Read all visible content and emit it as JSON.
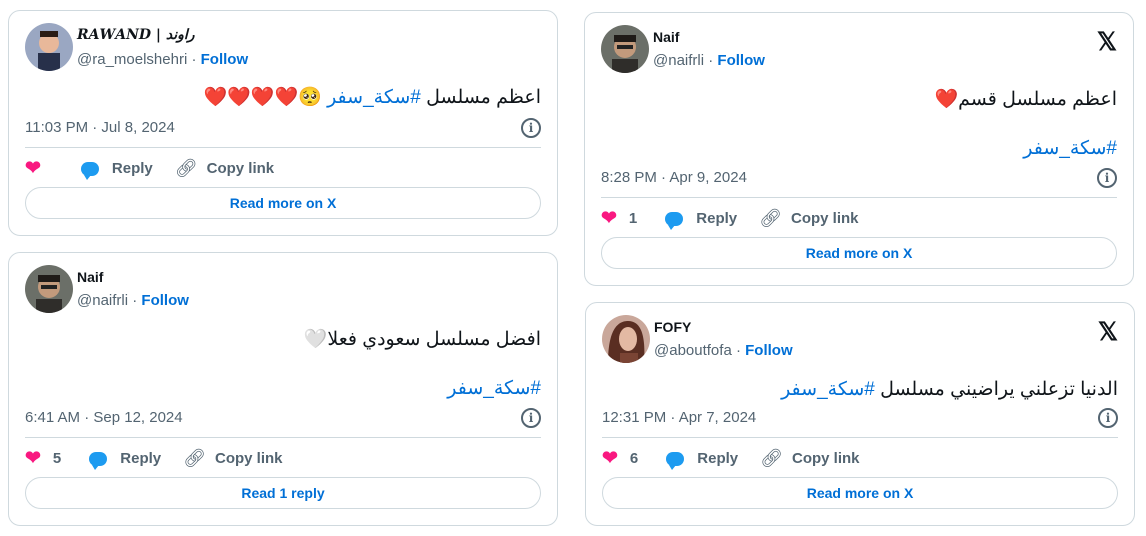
{
  "tweets": [
    {
      "name": "𝑹𝑨𝑾𝑨𝑵𝑫 | راوند",
      "handle": "@ra_moelshehri",
      "follow": "Follow",
      "text": "اعظم مسلسل ",
      "hashtag": "#سكة_سفر",
      "emojis": "🥺❤️❤️❤️❤️",
      "timestamp": "11:03 PM · Jul 8, 2024",
      "likes": "",
      "reply": "Reply",
      "copy_link": "Copy link",
      "cta": "Read more on X"
    },
    {
      "name": "Naif",
      "handle": "@naifrli",
      "follow": "Follow",
      "text": "افضل مسلسل سعودي فعلا",
      "emojis": "🤍",
      "hashtag": "#سكة_سفر",
      "timestamp": "6:41 AM · Sep 12, 2024",
      "likes": "5",
      "reply": "Reply",
      "copy_link": "Copy link",
      "cta": "Read 1 reply"
    },
    {
      "name": "Naif",
      "handle": "@naifrli",
      "follow": "Follow",
      "text": "اعظم مسلسل قسم",
      "emojis": "❤️",
      "hashtag": "#سكة_سفر",
      "timestamp": "8:28 PM · Apr 9, 2024",
      "likes": "1",
      "reply": "Reply",
      "copy_link": "Copy link",
      "cta": "Read more on X"
    },
    {
      "name": "FOFY",
      "handle": "@aboutfofa",
      "follow": "Follow",
      "text": "الدنيا تزعلني يراضيني مسلسل ",
      "hashtag": "#سكة_سفر",
      "timestamp": "12:31 PM · Apr 7, 2024",
      "likes": "6",
      "reply": "Reply",
      "copy_link": "Copy link",
      "cta": "Read more on X"
    }
  ],
  "icons": {
    "x_logo": "𝕏",
    "info": "i",
    "heart": "❤",
    "link": "🔗"
  },
  "colors": {
    "link_blue": "#006fd6",
    "heart_pink": "#f91880",
    "reply_blue": "#1d9bf0",
    "muted": "#536471",
    "border": "#cfd9de"
  }
}
